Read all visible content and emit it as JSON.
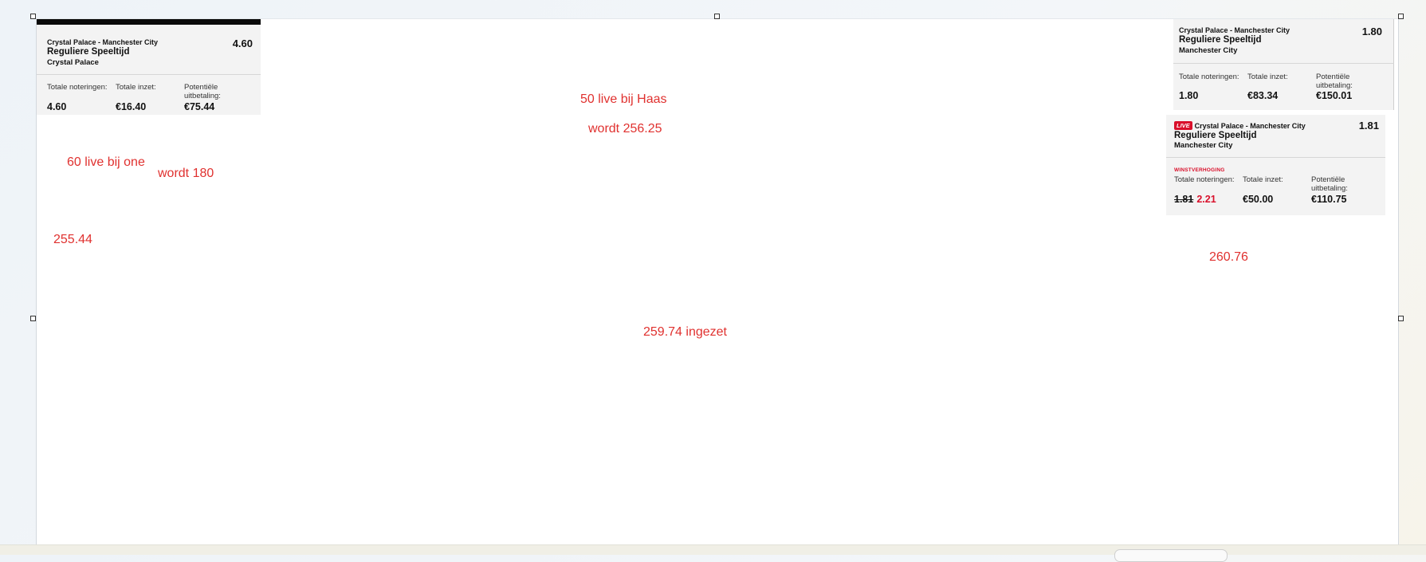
{
  "cards": {
    "left": {
      "match": "Crystal Palace - Manchester City",
      "market": "Reguliere Speeltijd",
      "selection": "Crystal Palace",
      "odds": "4.60",
      "labels": {
        "odds_total": "Totale noteringen:",
        "stake_total": "Totale inzet:",
        "payout": "Potentiële uitbetaling:"
      },
      "values": {
        "odds_total": "4.60",
        "stake_total": "€16.40",
        "payout": "€75.44"
      }
    },
    "right_top": {
      "match": "Crystal Palace - Manchester City",
      "market": "Reguliere Speeltijd",
      "selection": "Manchester City",
      "odds": "1.80",
      "labels": {
        "odds_total": "Totale noteringen:",
        "stake_total": "Totale inzet:",
        "payout": "Potentiële uitbetaling:"
      },
      "values": {
        "odds_total": "1.80",
        "stake_total": "€83.34",
        "payout": "€150.01"
      }
    },
    "right_live": {
      "live_badge": "LIVE",
      "match": "Crystal Palace - Manchester City",
      "market": "Reguliere Speeltijd",
      "selection": "Manchester City",
      "odds": "1.81",
      "boost_label": "WINSTVERHOGING",
      "labels": {
        "odds_total": "Totale noteringen:",
        "stake_total": "Totale inzet:",
        "payout": "Potentiële uitbetaling:"
      },
      "values": {
        "odds_old": "1.81",
        "odds_new": "2.21",
        "stake_total": "€50.00",
        "payout": "€110.75"
      }
    }
  },
  "annotations": {
    "haas": "50 live bij Haas",
    "wordt_256": "wordt 256.25",
    "one": "60 live bij one",
    "wordt_180": "wordt 180",
    "left_total": "255.44",
    "right_total": "260.76",
    "ingezet": "259.74 ingezet"
  },
  "colors": {
    "annotation": "#e0312f",
    "live_red": "#d9102b",
    "card_bg": "#f3f3f3"
  }
}
